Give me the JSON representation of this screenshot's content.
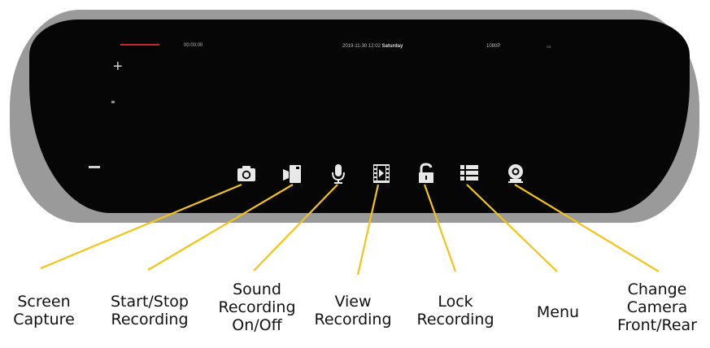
{
  "status_bar": {
    "recording_indicator": "REC",
    "timer": "00:00:00",
    "date_time": "2019-11-30  12:02",
    "weekday": "Saturday",
    "resolution": "1080P",
    "battery": "▭"
  },
  "zoom": {
    "zoom_in_glyph": "+",
    "zoom_out_glyph": "−"
  },
  "controls": [
    {
      "id": "screen-capture",
      "icon": "camera-icon",
      "label_lines": [
        "Screen",
        "Capture"
      ]
    },
    {
      "id": "start-stop-recording",
      "icon": "video-record-icon",
      "label_lines": [
        "Start/Stop",
        "Recording"
      ]
    },
    {
      "id": "sound-recording",
      "icon": "microphone-icon",
      "label_lines": [
        "Sound",
        "Recording",
        "On/Off"
      ]
    },
    {
      "id": "view-recording",
      "icon": "film-play-icon",
      "label_lines": [
        "View",
        "Recording"
      ]
    },
    {
      "id": "lock-recording",
      "icon": "unlock-icon",
      "label_lines": [
        "Lock",
        "Recording"
      ]
    },
    {
      "id": "menu",
      "icon": "menu-list-icon",
      "label_lines": [
        "Menu"
      ]
    },
    {
      "id": "change-camera",
      "icon": "camera-switch-icon",
      "label_lines": [
        "Change",
        "Camera",
        "Front/Rear"
      ]
    }
  ],
  "colors": {
    "bezel": "#9a9a9a",
    "screen": "#060606",
    "icon": "#e8e8e8",
    "callout_line": "#f3c316",
    "recording_red": "#c4272d"
  }
}
